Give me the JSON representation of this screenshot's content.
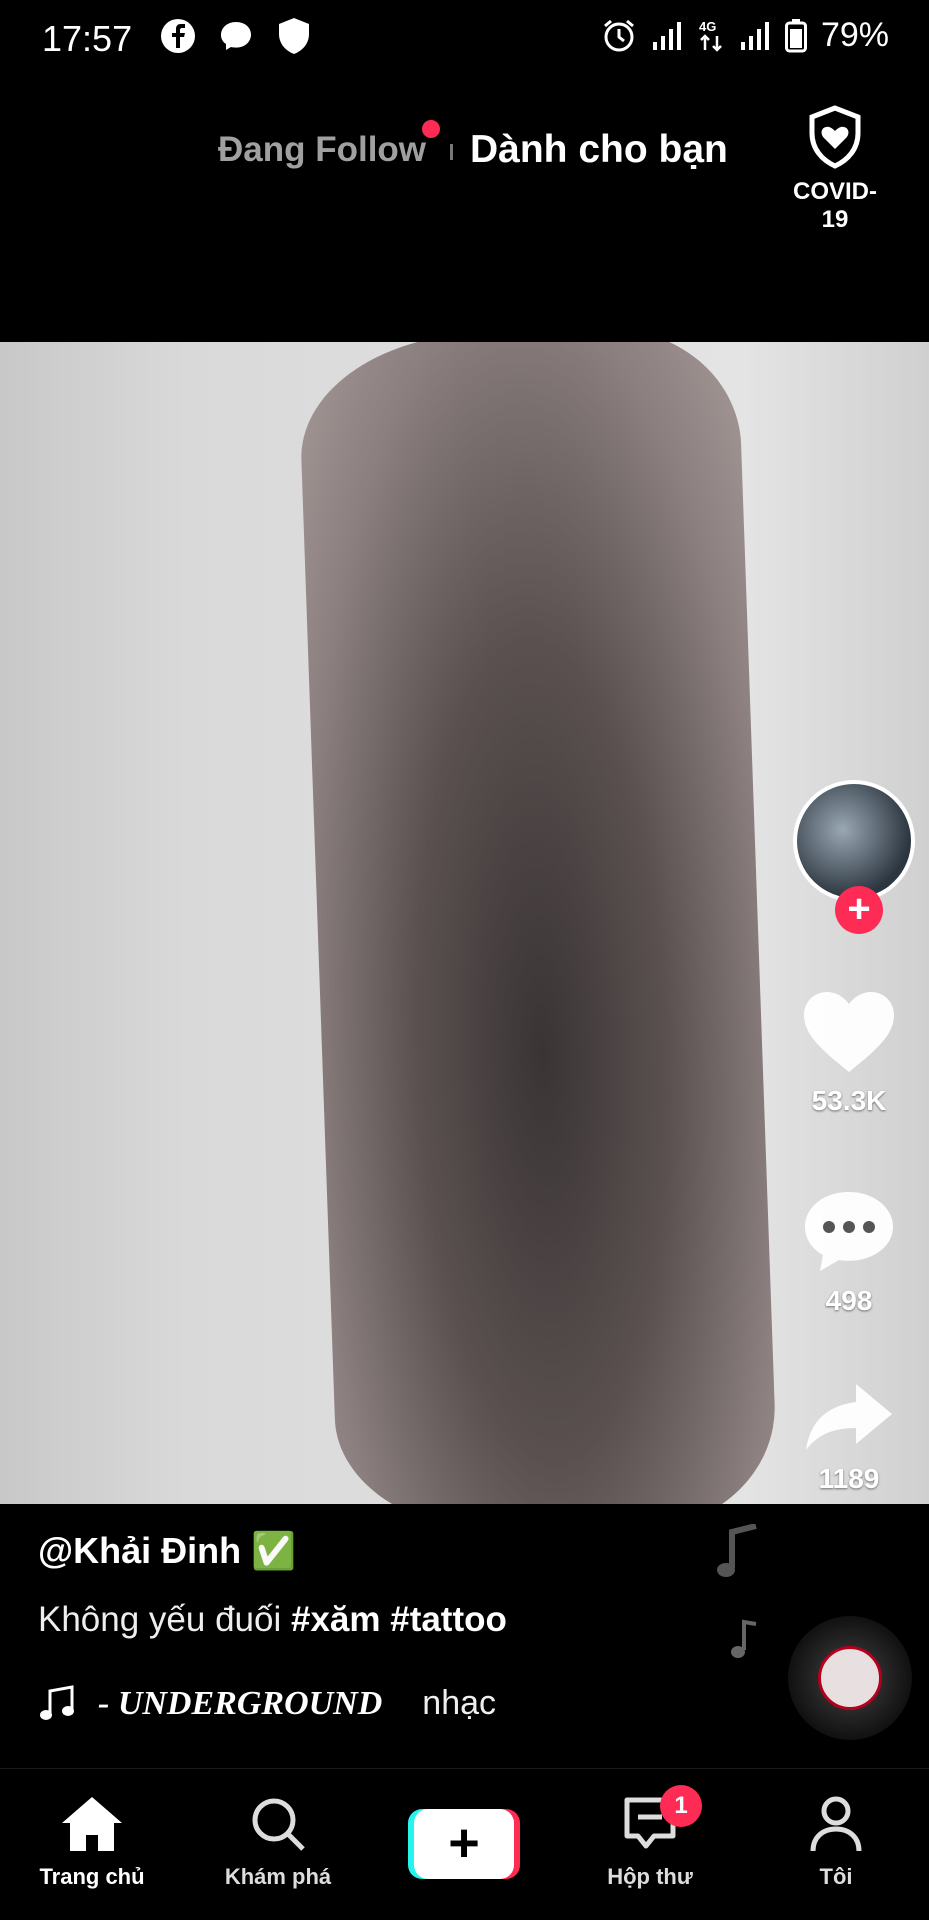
{
  "status_bar": {
    "time": "17:57",
    "battery": "79%",
    "left_icons": [
      "facebook-icon",
      "messenger-icon",
      "shield-icon"
    ],
    "right_icons": [
      "alarm-icon",
      "signal-icon",
      "4g-icon",
      "signal-icon",
      "battery-icon"
    ]
  },
  "top_nav": {
    "following": "Đang Follow",
    "for_you": "Dành cho bạn",
    "covid_label": "COVID-19"
  },
  "actions": {
    "likes": "53.3K",
    "comments": "498",
    "shares": "1189"
  },
  "caption": {
    "username": "@Khải Đinh ✅",
    "description_text": "Không yếu đuối ",
    "hashtags": "#xăm #tattoo",
    "music_title": "- UNDERGROUND",
    "music_sub": "nhạc"
  },
  "bottom_nav": {
    "home": "Trang chủ",
    "discover": "Khám phá",
    "inbox": "Hộp thư",
    "inbox_badge": "1",
    "profile": "Tôi"
  },
  "colors": {
    "accent": "#fe2c55",
    "cyan": "#25f4ee",
    "background": "#000000"
  }
}
